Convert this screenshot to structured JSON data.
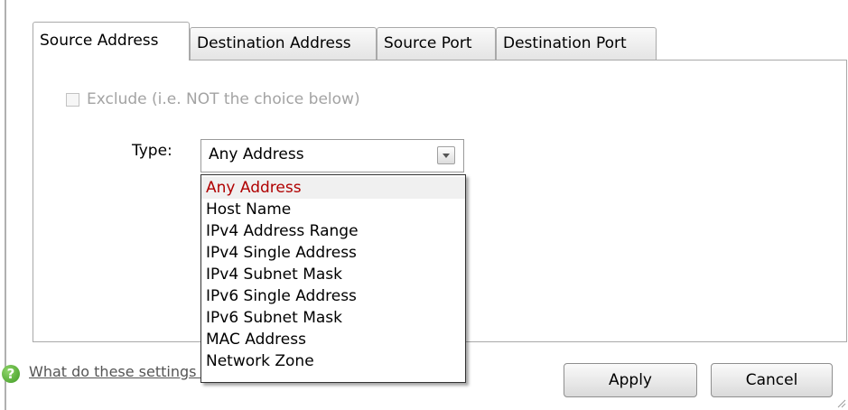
{
  "tabs": [
    {
      "label": "Source Address",
      "active": true
    },
    {
      "label": "Destination Address",
      "active": false
    },
    {
      "label": "Source Port",
      "active": false
    },
    {
      "label": "Destination Port",
      "active": false
    }
  ],
  "exclude": {
    "label": "Exclude (i.e. NOT the choice below)",
    "checked": false,
    "enabled": false
  },
  "type_field": {
    "label": "Type:",
    "value": "Any Address",
    "options": [
      "Any Address",
      "Host Name",
      "IPv4 Address Range",
      "IPv4 Single Address",
      "IPv4 Subnet Mask",
      "IPv6 Single Address",
      "IPv6 Subnet Mask",
      "MAC Address",
      "Network Zone"
    ]
  },
  "help": {
    "icon": "help-icon",
    "link_text": "What do these settings mean?"
  },
  "buttons": {
    "apply": "Apply",
    "cancel": "Cancel"
  },
  "colors": {
    "selected_option": "#b00000",
    "help_icon": "#4caf2a"
  }
}
